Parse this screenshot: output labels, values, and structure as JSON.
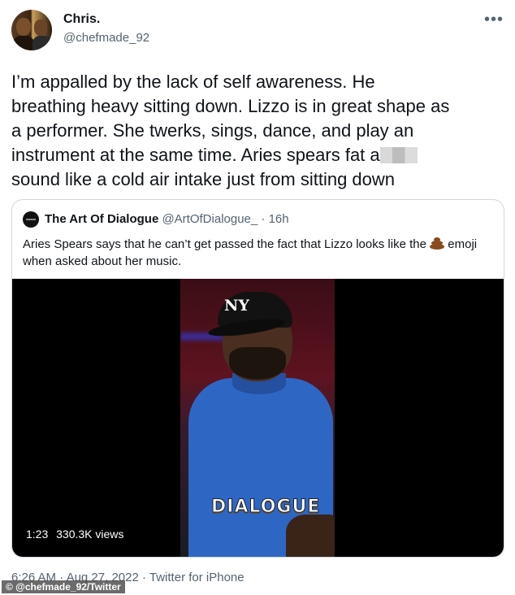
{
  "author": {
    "name": "Chris.",
    "handle": "@chefmade_92"
  },
  "menu_icon": "more-dots-icon",
  "tweet": {
    "text_lines": [
      "I’m appalled by the lack of self awareness. He",
      "breathing heavy sitting down. Lizzo is in great shape as",
      "a performer. She twerks, sings, dance, and play an",
      "instrument at the same time. Aries spears fat a",
      "sound like a cold air intake just from sitting down"
    ]
  },
  "quoted_tweet": {
    "name": "The Art Of Dialogue",
    "handle": "@ArtOfDialogue_",
    "separator": "·",
    "time": "16h",
    "text": "Aries Spears says that he can’t get passed the fact that Lizzo looks like the",
    "text_end": "emoji when asked about her music.",
    "emoji_icon": "pile-of-poo-emoji-icon",
    "video": {
      "cap_logo": "NY",
      "watermark": "DIALOGUE",
      "duration": "1:23",
      "views": "330.3K views"
    }
  },
  "footer": {
    "time": "6:26 AM",
    "date": "Aug 27, 2022",
    "separator": "·",
    "source": "Twitter for iPhone"
  },
  "photo_credit": "© @chefmade_92/Twitter"
}
